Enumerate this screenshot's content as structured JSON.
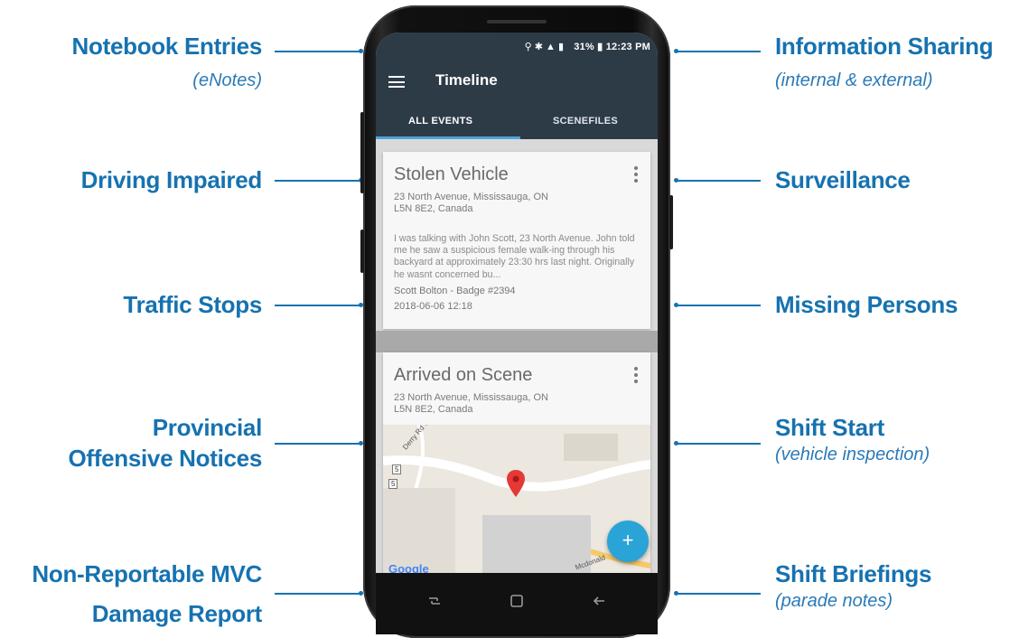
{
  "callouts_left": [
    {
      "title": "Notebook Entries",
      "subtitle": "(eNotes)"
    },
    {
      "title": "Driving Impaired",
      "subtitle": ""
    },
    {
      "title": "Traffic Stops",
      "subtitle": ""
    },
    {
      "title": "Provincial",
      "title2": "Offensive Notices",
      "subtitle": ""
    },
    {
      "title": "Non-Reportable MVC",
      "title2": "Damage Report",
      "subtitle": ""
    }
  ],
  "callouts_right": [
    {
      "title": "Information Sharing",
      "subtitle": "(internal & external)"
    },
    {
      "title": "Surveillance",
      "subtitle": ""
    },
    {
      "title": "Missing Persons",
      "subtitle": ""
    },
    {
      "title": "Shift Start",
      "subtitle": "(vehicle inspection)"
    },
    {
      "title": "Shift Briefings",
      "subtitle": "(parade notes)"
    }
  ],
  "status_bar": {
    "battery": "31%",
    "time": "12:23 PM"
  },
  "app_bar": {
    "title": "Timeline"
  },
  "tabs": [
    {
      "label": "ALL EVENTS",
      "active": true
    },
    {
      "label": "SCENEFILES",
      "active": false
    }
  ],
  "cards": [
    {
      "title": "Stolen Vehicle",
      "address_line1": "23 North Avenue, Mississauga, ON",
      "address_line2": "L5N 8E2, Canada",
      "body": "I was talking with John Scott, 23 North Avenue. John told me he saw a suspicious female walk-ing through his backyard at approximately 23:30 hrs last night. Originally he wasnt concerned bu...",
      "author": "Scott Bolton - Badge #2394",
      "timestamp": "2018-06-06 12:18"
    },
    {
      "title": "Arrived on Scene",
      "address_line1": "23 North Avenue, Mississauga, ON",
      "address_line2": "L5N 8E2, Canada"
    }
  ],
  "map": {
    "road_label_1": "Derry Rd W",
    "road_label_2": "Mcdonald",
    "attribution": "Google",
    "road_shield_1": "5",
    "road_shield_2": "5"
  },
  "fab": {
    "icon": "+"
  },
  "colors": {
    "accent": "#1672b0",
    "appbar": "#2d3b47",
    "fab": "#2aa3d6",
    "pin": "#e53935"
  }
}
